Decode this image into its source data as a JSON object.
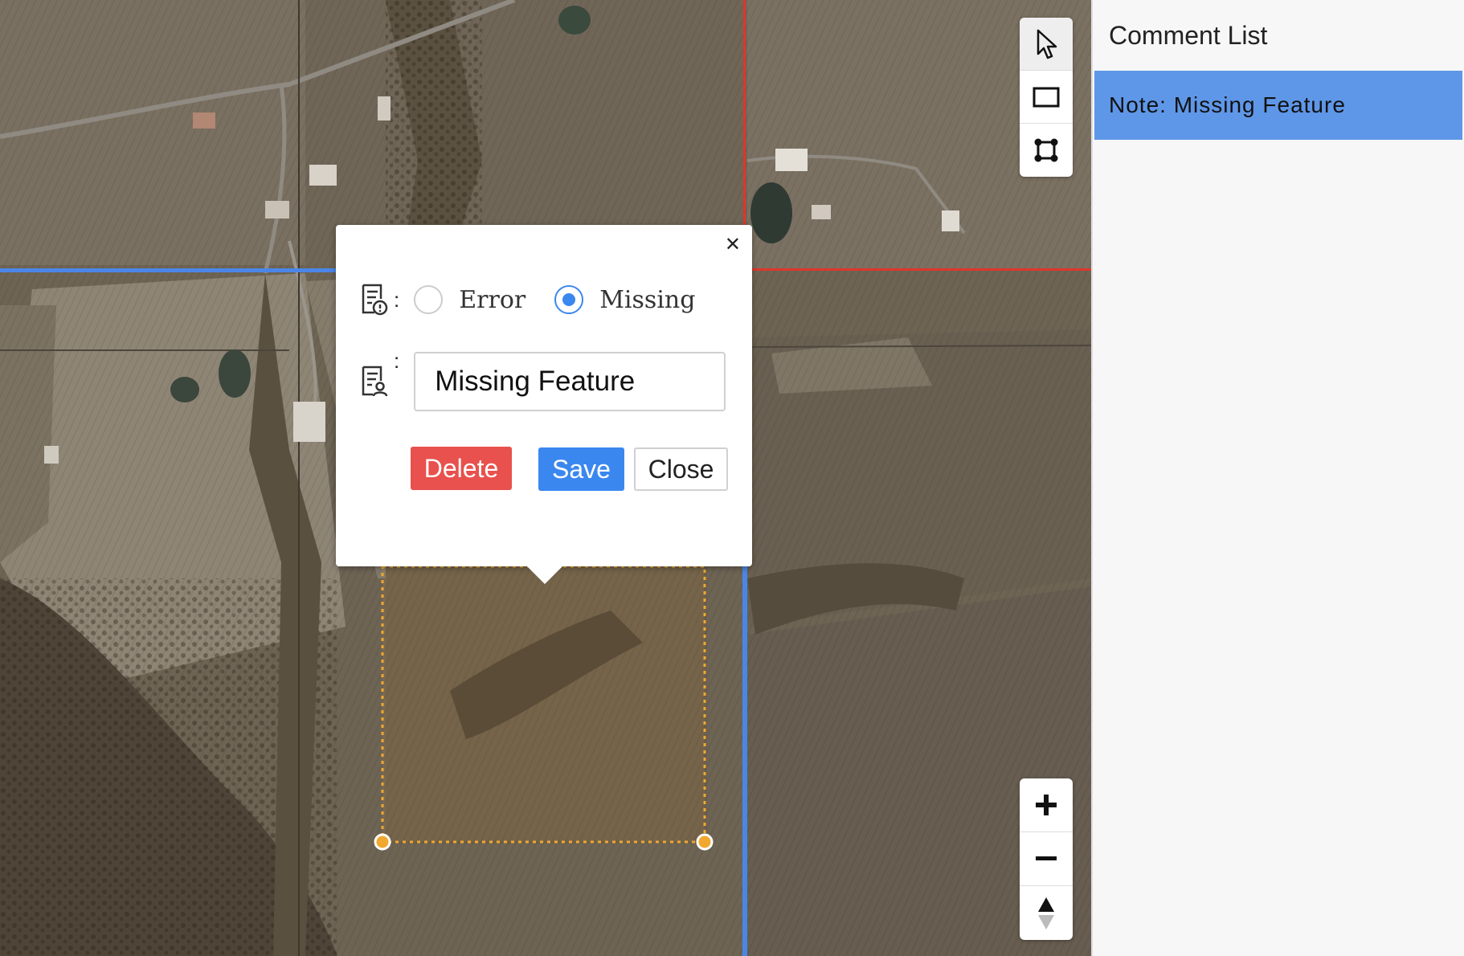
{
  "map": {
    "tools": [
      {
        "name": "select-tool",
        "icon": "cursor-arrow-icon",
        "active": true
      },
      {
        "name": "rectangle-tool",
        "icon": "rectangle-icon",
        "active": false
      },
      {
        "name": "polygon-tool",
        "icon": "polygon-vertices-icon",
        "active": false
      }
    ],
    "zoom_controls": [
      {
        "name": "zoom-in-button",
        "icon": "plus-icon"
      },
      {
        "name": "zoom-out-button",
        "icon": "minus-icon"
      },
      {
        "name": "reset-north-button",
        "icon": "compass-north-icon"
      }
    ],
    "colors": {
      "grid_red": "#e0352b",
      "grid_blue": "#4a86e8",
      "selection": "#f0a830"
    }
  },
  "popup": {
    "type_icon": "document-alert-icon",
    "text_icon": "document-user-icon",
    "options": [
      {
        "label": "Error",
        "checked": false
      },
      {
        "label": "Missing",
        "checked": true
      }
    ],
    "note_value": "Missing Feature",
    "delete_label": "Delete",
    "save_label": "Save",
    "close_label": "Close",
    "close_icon": "close-icon"
  },
  "sidebar": {
    "title": "Comment List",
    "items": [
      {
        "label": "Note: Missing Feature",
        "selected": true
      }
    ]
  }
}
